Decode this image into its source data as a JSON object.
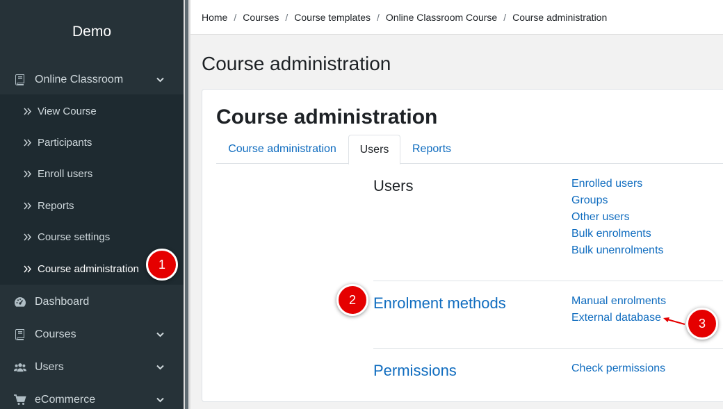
{
  "sidebar": {
    "brand": "Demo",
    "sections": {
      "online_classroom": "Online Classroom",
      "dashboard": "Dashboard",
      "courses": "Courses",
      "users": "Users",
      "ecommerce": "eCommerce"
    },
    "sub_items": [
      "View Course",
      "Participants",
      "Enroll users",
      "Reports",
      "Course settings",
      "Course administration"
    ],
    "active_sub_item": "Course administration"
  },
  "breadcrumb": [
    "Home",
    "Courses",
    "Course templates",
    "Online Classroom Course",
    "Course administration"
  ],
  "page_title": "Course administration",
  "card": {
    "title": "Course administration",
    "tabs": [
      "Course administration",
      "Users",
      "Reports"
    ],
    "active_tab": "Users",
    "sections": [
      {
        "heading": "Users",
        "links": [
          "Enrolled users",
          "Groups",
          "Other users",
          "Bulk enrolments",
          "Bulk unenrolments"
        ]
      },
      {
        "heading": "Enrolment methods",
        "links": [
          "Manual enrolments",
          "External database"
        ]
      },
      {
        "heading": "Permissions",
        "links": [
          "Check permissions"
        ]
      }
    ]
  },
  "markers": [
    "1",
    "2",
    "3"
  ],
  "colors": {
    "sidebar_bg": "#263238",
    "link": "#0f6cbf",
    "marker": "#e50000"
  }
}
